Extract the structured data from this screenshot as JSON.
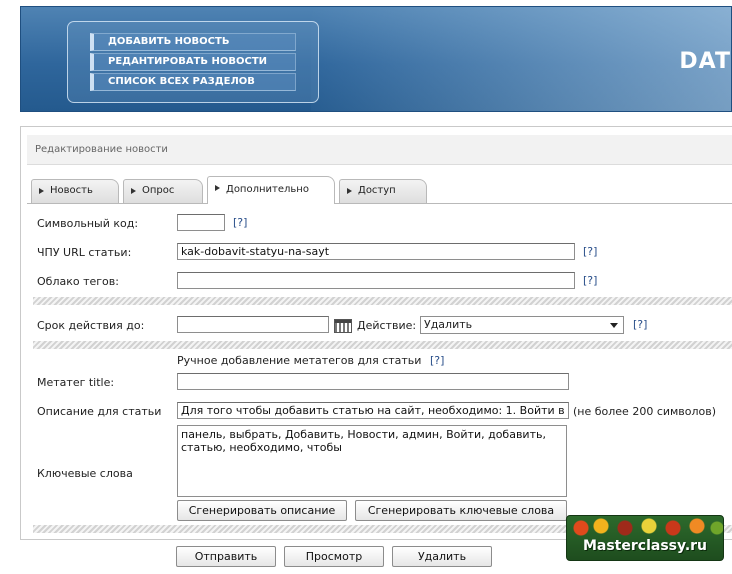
{
  "header": {
    "menu": [
      "ДОБАВИТЬ НОВОСТЬ",
      "РЕДАНТИРОВАТЬ НОВОСТИ",
      "СПИСОК ВСЕХ РАЗДЕЛОВ"
    ],
    "brand": "DAT"
  },
  "panel": {
    "title": "Редактирование новости",
    "tabs": [
      "Новость",
      "Опрос",
      "Дополнительно",
      "Доступ"
    ],
    "active_tab": "Дополнительно"
  },
  "form": {
    "help": "[?]",
    "symbol_code_label": "Символьный код:",
    "symbol_code_value": "",
    "url_label": "ЧПУ URL статьи:",
    "url_value": "kak-dobavit-statyu-na-sayt",
    "tags_label": "Облако тегов:",
    "tags_value": "",
    "expiry_label": "Срок действия до:",
    "expiry_value": "",
    "action_label": "Действие:",
    "action_value": "Удалить",
    "meta_heading": "Ручное добавление метатегов для статьи",
    "meta_title_label": "Метатег title:",
    "meta_title_value": "",
    "description_label": "Описание для статьи",
    "description_value": "Для того чтобы добавить статью на сайт, необходимо: 1. Войти в",
    "description_note": "(не более 200 символов)",
    "keywords_label": "Ключевые слова",
    "keywords_value": "панель, выбрать, Добавить, Новости, админ, Войти, добавить, статью, необходимо, чтобы",
    "gen_description_button": "Сгенерировать описание",
    "gen_keywords_button": "Сгенерировать ключевые слова"
  },
  "actions": {
    "submit": "Отправить",
    "preview": "Просмотр",
    "delete": "Удалить"
  },
  "watermark": "Masterclassy.ru",
  "colors": {
    "header": "#2f669c",
    "link": "#2a4f8a",
    "watermark_bg": "#2d6a2c"
  }
}
